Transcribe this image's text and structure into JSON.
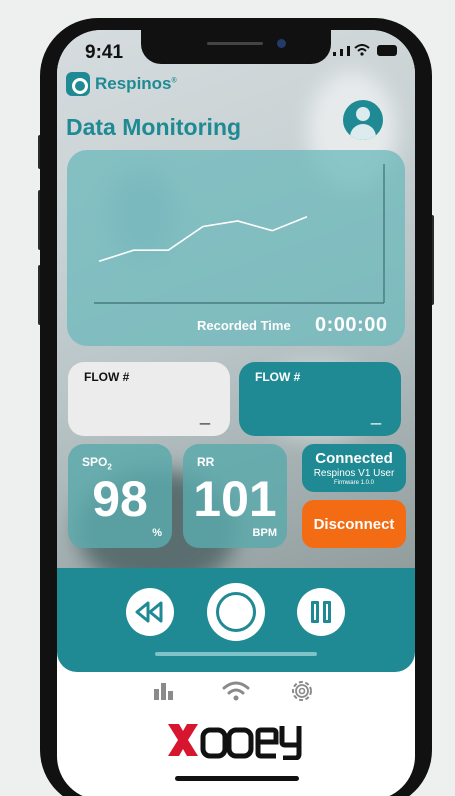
{
  "status": {
    "time": "9:41"
  },
  "brand": {
    "name": "Respinos",
    "mark": "®"
  },
  "header": {
    "title": "Data Monitoring"
  },
  "chart": {
    "recorded_label": "Recorded Time",
    "recorded_value": "0:00:00",
    "line_color": "#ffffff"
  },
  "chart_data": {
    "type": "line",
    "x": [
      0,
      1,
      2,
      3,
      4,
      5,
      6
    ],
    "series": [
      {
        "values": [
          0.3,
          0.38,
          0.38,
          0.55,
          0.59,
          0.52,
          0.62
        ]
      }
    ],
    "ylim": [
      0,
      1
    ],
    "xlabel": "",
    "ylabel": ""
  },
  "flow": [
    {
      "label": "FLOW #",
      "value": "_"
    },
    {
      "label": "FLOW #",
      "value": "_"
    }
  ],
  "vitals": {
    "spo2": {
      "label_main": "SPO",
      "label_sub": "2",
      "value": "98",
      "unit": "%"
    },
    "rr": {
      "label": "RR",
      "value": "101",
      "unit": "BPM"
    }
  },
  "connection": {
    "status": "Connected",
    "device": "Respinos V1 User",
    "firmware": "Firmware 1.0.0",
    "disconnect_label": "Disconnect"
  },
  "controls": [
    "rewind-icon",
    "record-icon",
    "pause-icon"
  ],
  "tabs": [
    "bar-chart-icon",
    "wifi-icon",
    "gear-icon"
  ],
  "footer": {
    "logo": "Xooey"
  },
  "colors": {
    "primary": "#1f8a93",
    "accent": "#f36b12",
    "card": "#ececec"
  }
}
